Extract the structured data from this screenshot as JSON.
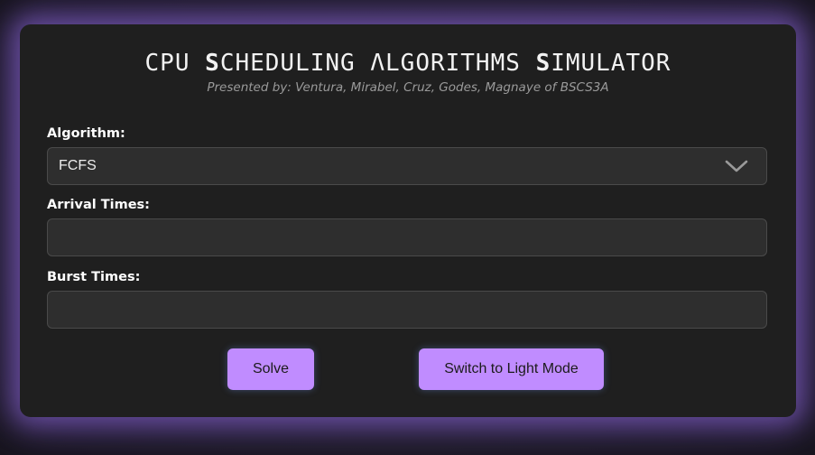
{
  "header": {
    "title_parts": [
      {
        "text": "CPU ",
        "bold": false
      },
      {
        "text": "S",
        "bold": true
      },
      {
        "text": "CHEDULING ",
        "bold": false
      },
      {
        "text": "Λ",
        "bold": false
      },
      {
        "text": "LGORITHMS ",
        "bold": false
      },
      {
        "text": "S",
        "bold": true
      },
      {
        "text": "IMULATOR",
        "bold": false
      }
    ],
    "subtitle": "Presented by: Ventura, Mirabel, Cruz, Godes, Magnaye of BSCS3A"
  },
  "form": {
    "algorithm_label": "Algorithm:",
    "algorithm_value": "FCFS",
    "arrival_label": "Arrival Times:",
    "arrival_value": "",
    "burst_label": "Burst Times:",
    "burst_value": ""
  },
  "buttons": {
    "solve_label": "Solve",
    "theme_label": "Switch to Light Mode"
  },
  "icons": {
    "dropdown": "chevron-down-icon"
  },
  "colors": {
    "accent": "#c08cff",
    "card": "#1f1f1f",
    "glow": "#9a6ee6"
  }
}
